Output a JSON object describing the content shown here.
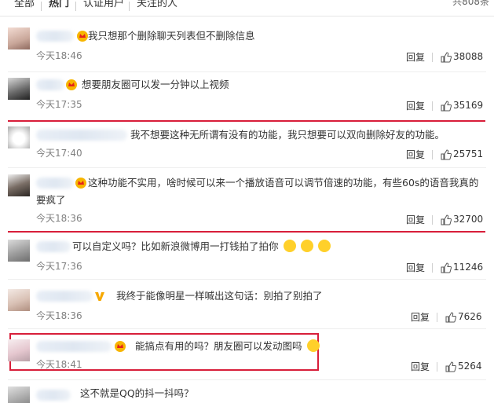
{
  "tabs": {
    "all": "全部",
    "hot": "热门",
    "verified": "认证用户",
    "following": "关注的人",
    "total": "共808条"
  },
  "reply_label": "回复",
  "comments": [
    {
      "text": "我只想那个删除聊天列表但不删除信息",
      "time": "今天18:46",
      "likes": "38088"
    },
    {
      "text": "想要朋友圈可以发一分钟以上视频",
      "time": "今天17:35",
      "likes": "35169"
    },
    {
      "text": "我不想要这种无所谓有没有的功能，我只想要可以双向删除好友的功能。",
      "time": "今天17:40",
      "likes": "25751"
    },
    {
      "text": "这种功能不实用，啥时候可以来一个播放语音可以调节倍速的功能，有些60s的语音我真的要疯了",
      "time": "今天18:36",
      "likes": "32700"
    },
    {
      "text": "可以自定义吗？比如新浪微博用一打钱拍了拍你",
      "time": "今天17:36",
      "likes": "11246"
    },
    {
      "text": "我终于能像明星一样喊出这句话：别拍了别拍了",
      "time": "今天18:36",
      "likes": "7626"
    },
    {
      "text": "能搞点有用的吗？朋友圈可以发动图吗",
      "time": "今天18:41",
      "likes": "5264"
    },
    {
      "text": "这不就是QQ的抖一抖吗？"
    }
  ],
  "icons": {
    "thumb": "thumbs-up-icon",
    "badge": "crown-badge-icon",
    "verified": "verified-v-icon",
    "emoji": "face-emoji-icon"
  },
  "colors": {
    "username": "#eb7350",
    "highlight": "#d81e3a",
    "time": "#808080"
  }
}
